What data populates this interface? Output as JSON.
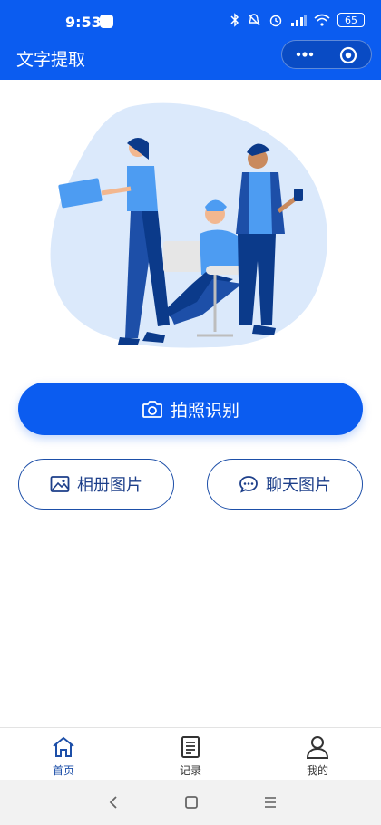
{
  "status_bar": {
    "time": "9:53",
    "battery": "65"
  },
  "nav": {
    "title": "文字提取"
  },
  "actions": {
    "camera_label": "拍照识别",
    "album_label": "相册图片",
    "chat_label": "聊天图片"
  },
  "tab_bar": {
    "items": [
      {
        "label": "首页",
        "icon": "home-icon",
        "active": true
      },
      {
        "label": "记录",
        "icon": "document-icon",
        "active": false
      },
      {
        "label": "我的",
        "icon": "user-icon",
        "active": false
      }
    ]
  },
  "colors": {
    "primary": "#0b5cf0",
    "outline": "#1d4fa8",
    "illustration_blob": "#dbe9fb"
  }
}
